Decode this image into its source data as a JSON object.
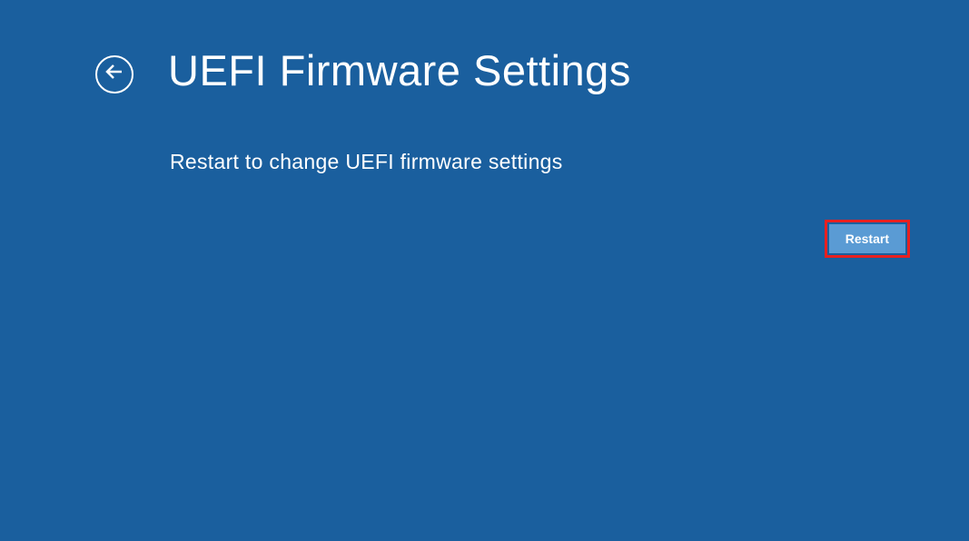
{
  "header": {
    "title": "UEFI Firmware Settings"
  },
  "main": {
    "description": "Restart to change UEFI firmware settings"
  },
  "buttons": {
    "restart_label": "Restart"
  }
}
